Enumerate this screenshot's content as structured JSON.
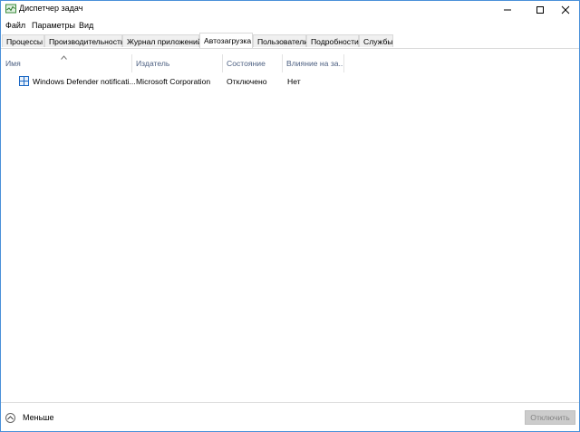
{
  "window": {
    "title": "Диспетчер задач"
  },
  "menu": {
    "items": [
      {
        "label": "Файл"
      },
      {
        "label": "Параметры"
      },
      {
        "label": "Вид"
      }
    ]
  },
  "tabs": [
    {
      "label": "Процессы"
    },
    {
      "label": "Производительность"
    },
    {
      "label": "Журнал приложений"
    },
    {
      "label": "Автозагрузка",
      "active": true
    },
    {
      "label": "Пользователи"
    },
    {
      "label": "Подробности"
    },
    {
      "label": "Службы"
    }
  ],
  "table": {
    "columns": [
      "Имя",
      "Издатель",
      "Состояние",
      "Влияние на за..."
    ],
    "sort_column": "Имя",
    "sort_direction": "ascending",
    "rows": [
      {
        "icon": "shield-defender-icon",
        "name": "Windows Defender notificati...",
        "publisher": "Microsoft Corporation",
        "status": "Отключено",
        "impact": "Нет"
      }
    ]
  },
  "footer": {
    "less_label": "Меньше",
    "disable_label": "Отключить",
    "disable_enabled": false
  },
  "colors": {
    "window_border": "#4a90d9",
    "header_text": "#4d6082",
    "tab_bg": "#f0f0f0",
    "button_disabled_bg": "#cccccc"
  }
}
